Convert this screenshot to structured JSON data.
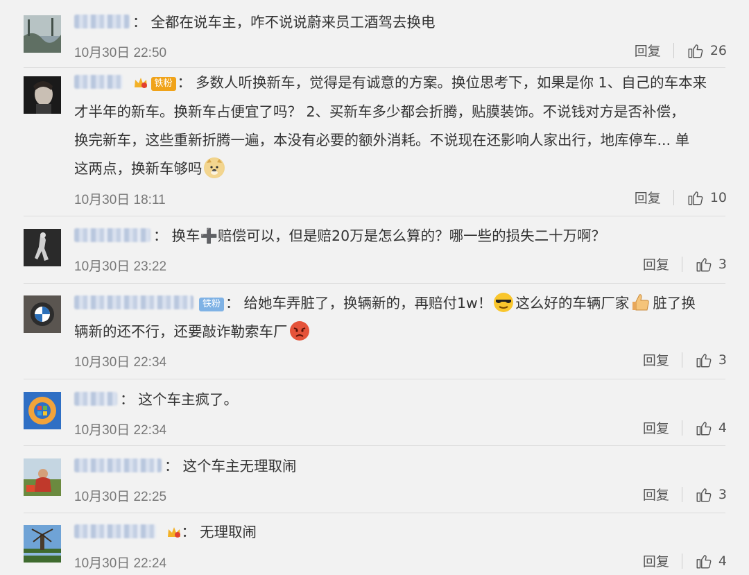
{
  "like_glyph": "thumbs-up-icon",
  "comments": [
    {
      "text": "全都在说车主，咋不说说蔚来员工酒驾去换电",
      "time": "10月30日 22:50",
      "reply": "回复",
      "likes": "26"
    },
    {
      "badge": "铁粉",
      "line1": "多数人听换新车，觉得是有诚意的方案。换位思考下，如果是你 1、自己的车本来",
      "line2": "才半年的新车。换新车占便宜了吗？ 2、买新车多少都会折腾，贴膜装饰。不说钱对方是否补偿，",
      "line3": "换完新车，这些重新折腾一遍，本没有必要的额外消耗。不说现在还影响人家出行，地库停车... 单",
      "line4": "这两点，换新车够吗",
      "time": "10月30日 18:11",
      "reply": "回复",
      "likes": "10"
    },
    {
      "text": "换车➕赔偿可以，但是赔20万是怎么算的？哪一些的损失二十万啊？",
      "time": "10月30日 23:22",
      "reply": "回复",
      "likes": "3"
    },
    {
      "badge": "铁粉",
      "seg1": "给她车弄脏了，换辆新的，再赔付1w！",
      "seg2": "这么好的车辆厂家",
      "seg3": "脏了换",
      "line2": "辆新的还不行，还要敲诈勒索车厂",
      "time": "10月30日 22:34",
      "reply": "回复",
      "likes": "3"
    },
    {
      "text": "这个车主疯了。",
      "time": "10月30日 22:34",
      "reply": "回复",
      "likes": "4"
    },
    {
      "text": "这个车主无理取闹",
      "time": "10月30日 22:25",
      "reply": "回复",
      "likes": "3"
    },
    {
      "text": "无理取闹",
      "time": "10月30日 22:24",
      "reply": "回复",
      "likes": "4"
    }
  ]
}
